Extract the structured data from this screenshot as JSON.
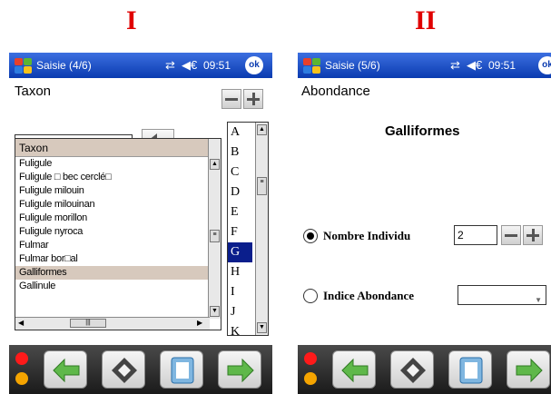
{
  "labels": {
    "left": "I",
    "right": "II"
  },
  "statusbar": {
    "signal_icon": "⇄",
    "speaker_icon": "◀€",
    "ok_label": "ok",
    "left_time": "09:51",
    "right_time": "09:51"
  },
  "screen1": {
    "title": "Saisie (4/6)",
    "heading": "Taxon",
    "search_value": "G",
    "list_header": "Taxon",
    "list_items": [
      "Fuligule",
      "Fuligule □ bec cerclé□",
      "Fuligule milouin",
      "Fuligule milouinan",
      "Fuligule morillon",
      "Fuligule nyroca",
      "Fulmar",
      "Fulmar bor□al",
      "Galliformes",
      "Gallinule"
    ],
    "selected_item": 8,
    "alphabet": [
      "A",
      "B",
      "C",
      "D",
      "E",
      "F",
      "G",
      "H",
      "I",
      "J",
      "K"
    ],
    "selected_letter": 6
  },
  "screen2": {
    "title": "Saisie (5/6)",
    "heading": "Abondance",
    "taxon_name": "Galliformes",
    "radio1_label": "Nombre Individu",
    "radio1_value": "2",
    "radio2_label": "Indice Abondance",
    "dropdown_value": ""
  },
  "colors": {
    "titlebar": "#0a3bb0",
    "selection": "#d7c9bd",
    "letter_selected": "#0a1e8c",
    "roman": "#e00000"
  }
}
